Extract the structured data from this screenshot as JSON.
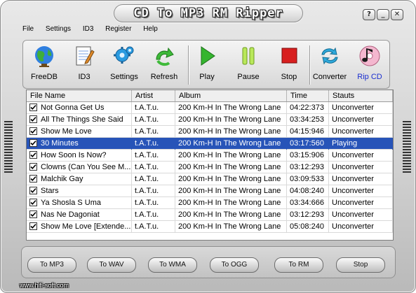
{
  "window": {
    "title": "CD To MP3 RM Ripper",
    "help_btn": "?",
    "minimize_btn": "_",
    "close_btn": "✕"
  },
  "menu": [
    "File",
    "Settings",
    "ID3",
    "Register",
    "Help"
  ],
  "toolbar": [
    {
      "label": "FreeDB",
      "icon": "globe-icon"
    },
    {
      "label": "ID3",
      "icon": "notepad-icon"
    },
    {
      "label": "Settings",
      "icon": "gear-icon"
    },
    {
      "label": "Refresh",
      "icon": "refresh-arrow-icon"
    },
    {
      "label": "Play",
      "icon": "play-icon"
    },
    {
      "label": "Pause",
      "icon": "pause-icon"
    },
    {
      "label": "Stop",
      "icon": "stop-icon"
    },
    {
      "label": "Converter",
      "icon": "converter-icon"
    },
    {
      "label": "Rip CD",
      "icon": "rip-cd-icon"
    }
  ],
  "columns": [
    "File Name",
    "Artist",
    "Album",
    "Time",
    "Stauts"
  ],
  "rows": [
    {
      "name": "Not Gonna Get Us",
      "artist": "t.A.T.u.",
      "album": "200 Km-H In The Wrong Lane",
      "time": "04:22:373",
      "status": "Unconverter",
      "checked": true,
      "selected": false
    },
    {
      "name": "All The Things She Said",
      "artist": "t.A.T.u.",
      "album": "200 Km-H In The Wrong Lane",
      "time": "03:34:253",
      "status": "Unconverter",
      "checked": true,
      "selected": false
    },
    {
      "name": "Show Me Love",
      "artist": "t.A.T.u.",
      "album": "200 Km-H In The Wrong Lane",
      "time": "04:15:946",
      "status": "Unconverter",
      "checked": true,
      "selected": false
    },
    {
      "name": "30 Minutes",
      "artist": "t.A.T.u.",
      "album": "200 Km-H In The Wrong Lane",
      "time": "03:17:560",
      "status": "Playing",
      "checked": true,
      "selected": true
    },
    {
      "name": "How Soon Is Now?",
      "artist": "t.A.T.u.",
      "album": "200 Km-H In The Wrong Lane",
      "time": "03:15:906",
      "status": "Unconverter",
      "checked": true,
      "selected": false
    },
    {
      "name": "Clowns (Can You See M...",
      "artist": "t.A.T.u.",
      "album": "200 Km-H In The Wrong Lane",
      "time": "03:12:293",
      "status": "Unconverter",
      "checked": true,
      "selected": false
    },
    {
      "name": "Malchik Gay",
      "artist": "t.A.T.u.",
      "album": "200 Km-H In The Wrong Lane",
      "time": "03:09:533",
      "status": "Unconverter",
      "checked": true,
      "selected": false
    },
    {
      "name": "Stars",
      "artist": "t.A.T.u.",
      "album": "200 Km-H In The Wrong Lane",
      "time": "04:08:240",
      "status": "Unconverter",
      "checked": true,
      "selected": false
    },
    {
      "name": "Ya Shosla S Uma",
      "artist": "t.A.T.u.",
      "album": "200 Km-H In The Wrong Lane",
      "time": "03:34:666",
      "status": "Unconverter",
      "checked": true,
      "selected": false
    },
    {
      "name": "Nas Ne Dagoniat",
      "artist": "t.A.T.u.",
      "album": "200 Km-H In The Wrong Lane",
      "time": "03:12:293",
      "status": "Unconverter",
      "checked": true,
      "selected": false
    },
    {
      "name": "Show Me Love [Extende...",
      "artist": "t.A.T.u.",
      "album": "200 Km-H In The Wrong Lane",
      "time": "05:08:240",
      "status": "Unconverter",
      "checked": true,
      "selected": false
    }
  ],
  "buttons": [
    "To MP3",
    "To WAV",
    "To WMA",
    "To OGG",
    "To RM",
    "Stop"
  ],
  "footer": "www.hifi-soft.com",
  "colors": {
    "selection": "#2754b8",
    "active_label": "#1a2fd0"
  }
}
